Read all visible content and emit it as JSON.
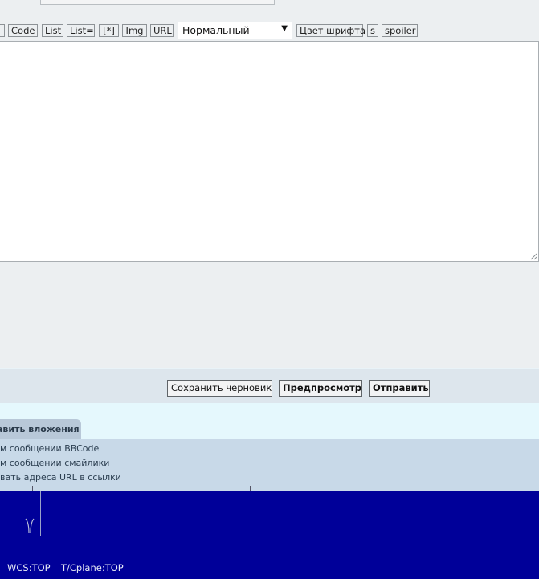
{
  "toolbar": {
    "buttons": [
      "Code",
      "List",
      "List=",
      "[*]",
      "Img",
      "URL"
    ],
    "font_size_select": "Нормальный",
    "font_color_button": "Цвет шрифта",
    "strike_button": "s",
    "spoiler_button": "spoiler"
  },
  "editor": {
    "value": ""
  },
  "actions": {
    "save_draft": "Сохранить черновик",
    "preview": "Предпросмотр",
    "submit": "Отправить"
  },
  "tabs": {
    "attachments": "авить вложения"
  },
  "options": {
    "bbcode": "м сообщении BBCode",
    "smilies": "м сообщении смайлики",
    "urls": "вать адреса URL в ссылки"
  },
  "cad": {
    "wcs": "WCS:TOP",
    "cplane": "T/Cplane:TOP",
    "colors": {
      "background": "#000099"
    }
  },
  "colors": {
    "page": "#eceff1",
    "button_row": "#dde6ed",
    "options_panel": "#c8d9e8"
  }
}
